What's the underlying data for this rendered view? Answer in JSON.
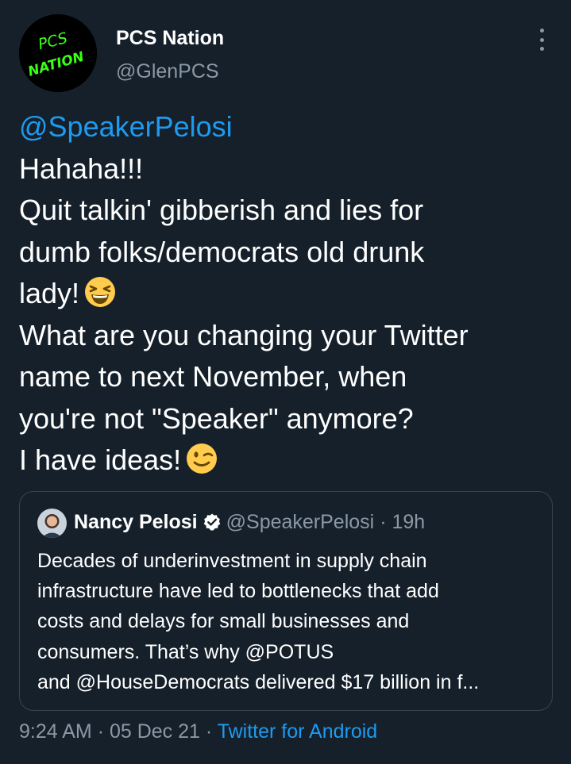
{
  "author": {
    "display_name": "PCS Nation",
    "handle": "@GlenPCS",
    "avatar_text_top": "PCS",
    "avatar_text_bottom": "NATION"
  },
  "tweet": {
    "mention": "@SpeakerPelosi",
    "lines": [
      "Hahaha!!!",
      "Quit talkin' gibberish and lies for",
      "dumb folks/democrats old drunk",
      "lady!",
      "What are you changing your Twitter",
      "name to next November, when",
      "you're not \"Speaker\" anymore?",
      "I have ideas!"
    ]
  },
  "quote": {
    "name": "Nancy Pelosi",
    "handle": "@SpeakerPelosi",
    "separator": "·",
    "time": "19h",
    "lines": [
      "Decades of underinvestment in supply chain",
      "infrastructure have led to bottlenecks that add",
      "costs and delays for small businesses and",
      "consumers. That’s why @POTUS",
      "and @HouseDemocrats delivered $17 billion in f..."
    ]
  },
  "meta": {
    "time": "9:24 AM",
    "sep1": "·",
    "date": "05 Dec 21",
    "sep2": "·",
    "source": "Twitter for Android"
  },
  "colors": {
    "background": "#15202b",
    "link": "#1d9bf0",
    "secondary_text": "#8b98a5",
    "border": "#38444d",
    "avatar_text": "#39ff14"
  },
  "icons": {
    "more": "more-vertical-icon",
    "verified": "verified-badge-icon",
    "laughing_emoji": "grinning-squinting-face-emoji",
    "winking_emoji": "winking-face-emoji"
  }
}
